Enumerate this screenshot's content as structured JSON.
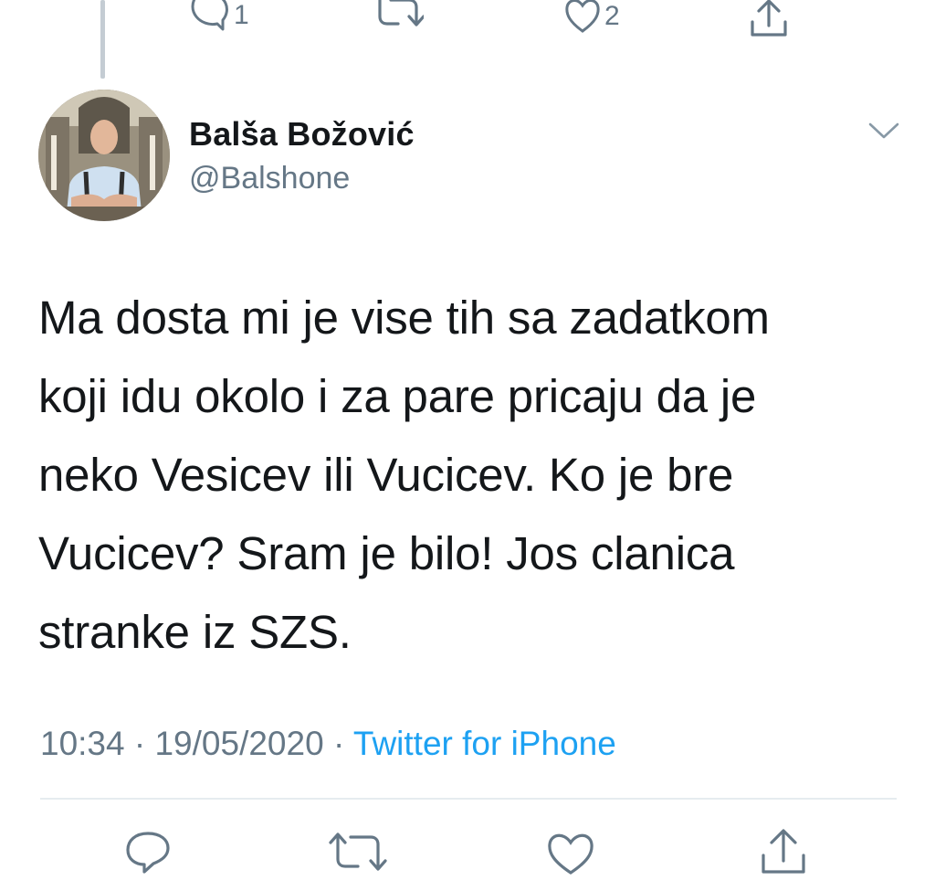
{
  "prev_tweet": {
    "reply_count": "1",
    "like_count": "2"
  },
  "tweet": {
    "author_name": "Balša Božović",
    "author_handle": "@Balshone",
    "text": "Ma dosta mi je vise tih sa zadatkom\nkoji idu okolo i za pare pricaju da je\nneko Vesicev ili Vucicev. Ko je bre\nVucicev? Sram je bilo! Jos clanica\nstranke iz SZS.",
    "time": "10:34",
    "date": "19/05/2020",
    "separator": " · ",
    "source": "Twitter for iPhone"
  },
  "icons": {
    "reply": "reply-icon",
    "retweet": "retweet-icon",
    "like": "like-icon",
    "share": "share-icon",
    "more": "chevron-down-icon"
  },
  "colors": {
    "text": "#14171a",
    "secondary": "#657786",
    "link": "#1da1f2",
    "divider": "#e6ecf0"
  }
}
